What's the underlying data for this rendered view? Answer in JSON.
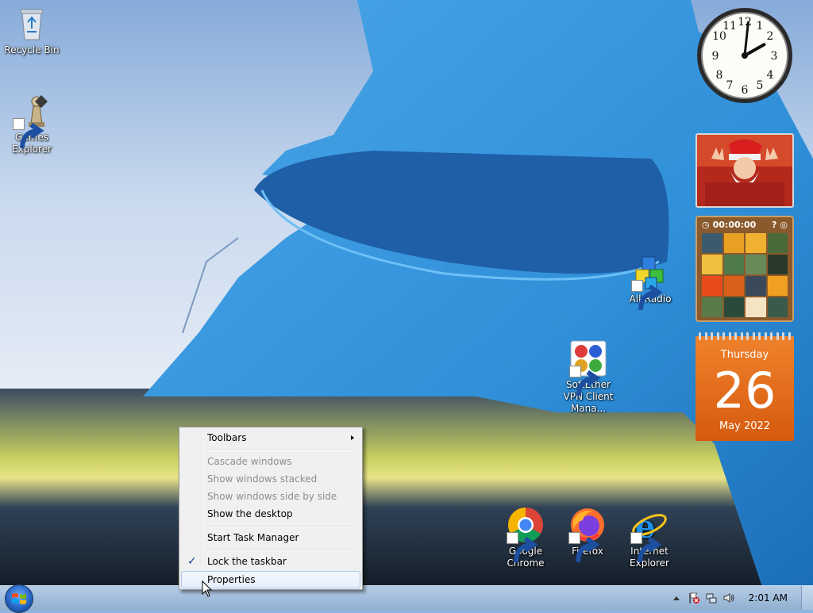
{
  "desktop": {
    "icons": [
      {
        "label": "Recycle Bin",
        "icon": "recycle-bin-icon"
      },
      {
        "label": "Games Explorer",
        "icon": "games-explorer-icon"
      },
      {
        "label": "All-Radio",
        "icon": "all-radio-icon"
      },
      {
        "label": "SoftEther VPN Client Mana...",
        "icon": "softether-vpn-icon"
      },
      {
        "label": "Google Chrome",
        "icon": "chrome-icon"
      },
      {
        "label": "Firefox",
        "icon": "firefox-icon"
      },
      {
        "label": "Internet Explorer",
        "icon": "internet-explorer-icon"
      }
    ]
  },
  "gadgets": {
    "clock": {
      "hour": 2,
      "minute": 1
    },
    "puzzle": {
      "timer": "00:00:00"
    },
    "calendar": {
      "day_name": "Thursday",
      "day": "26",
      "month_year": "May 2022"
    }
  },
  "context_menu": {
    "items": [
      {
        "label": "Toolbars",
        "enabled": true,
        "submenu": true
      },
      {
        "label": "Cascade windows",
        "enabled": false
      },
      {
        "label": "Show windows stacked",
        "enabled": false
      },
      {
        "label": "Show windows side by side",
        "enabled": false
      },
      {
        "label": "Show the desktop",
        "enabled": true
      },
      {
        "label": "Start Task Manager",
        "enabled": true
      },
      {
        "label": "Lock the taskbar",
        "enabled": true,
        "checked": true
      },
      {
        "label": "Properties",
        "enabled": true,
        "hover": true
      }
    ]
  },
  "taskbar": {
    "clock": "2:01 AM",
    "colors": {
      "accent": "#2665c4",
      "calendar": "#e86d1e"
    }
  }
}
